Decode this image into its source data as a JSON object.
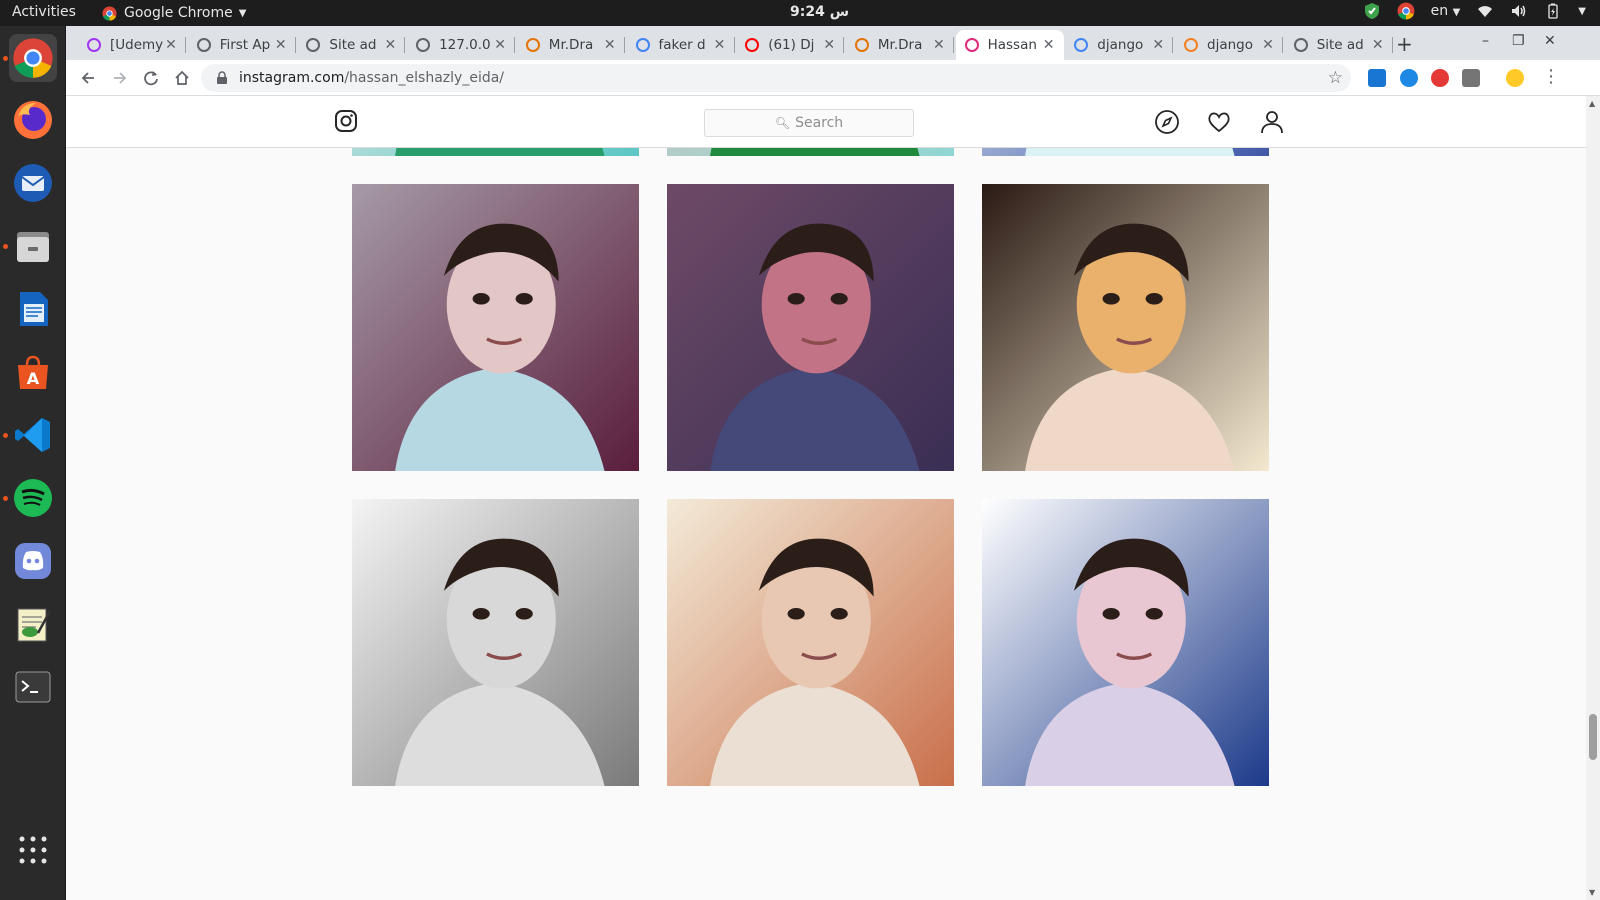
{
  "topbar": {
    "activities": "Activities",
    "app_name": "Google Chrome",
    "clock": "9:24 س",
    "lang": "en"
  },
  "browser": {
    "tabs": [
      {
        "title": "[Udemy",
        "favicon": "udemy-icon",
        "color": "#a435f0"
      },
      {
        "title": "First Ap",
        "favicon": "globe-icon",
        "color": "#5f6368"
      },
      {
        "title": "Site ad",
        "favicon": "globe-icon",
        "color": "#5f6368"
      },
      {
        "title": "127.0.0",
        "favicon": "globe-icon",
        "color": "#5f6368"
      },
      {
        "title": "Mr.Dra",
        "favicon": "bar-chart-icon",
        "color": "#e37400"
      },
      {
        "title": "faker d",
        "favicon": "google-icon",
        "color": "#4285f4"
      },
      {
        "title": "(61) Dj",
        "favicon": "youtube-icon",
        "color": "#ff0000"
      },
      {
        "title": "Mr.Dra",
        "favicon": "bar-chart-icon",
        "color": "#e37400"
      },
      {
        "title": "Hassan",
        "favicon": "instagram-icon",
        "color": "#dd2a7b",
        "active": true
      },
      {
        "title": "django",
        "favicon": "google-icon",
        "color": "#4285f4"
      },
      {
        "title": "django",
        "favicon": "stack-icon",
        "color": "#f48024"
      },
      {
        "title": "Site ad",
        "favicon": "globe-icon",
        "color": "#5f6368"
      }
    ],
    "url_host": "instagram.com",
    "url_path": "/hassan_elshazly_eida/"
  },
  "instagram": {
    "search_placeholder": "Search"
  },
  "grid": [
    {
      "id": "photo-1",
      "bg": [
        "#f4efe9",
        "#5cc6c4"
      ],
      "shirt": "#2a9d6c",
      "face": "#e6c4b4"
    },
    {
      "id": "photo-2",
      "bg": [
        "#d8c3bd",
        "#8fd6d4"
      ],
      "shirt": "#1f8a3b",
      "face": "#d7a99a"
    },
    {
      "id": "photo-3",
      "bg": [
        "#eaf4f7",
        "#4058a8"
      ],
      "shirt": "#dbf2f5",
      "face": "#e8d1c6"
    },
    {
      "id": "photo-4",
      "bg": [
        "#a69aa6",
        "#5a1e3c"
      ],
      "shirt": "#b5d8e3",
      "face": "#e3c6c6"
    },
    {
      "id": "photo-5",
      "bg": [
        "#6d4a66",
        "#3a2e54"
      ],
      "shirt": "#45497a",
      "face": "#c37386"
    },
    {
      "id": "photo-6",
      "bg": [
        "#2a1a14",
        "#f4e8cf"
      ],
      "shirt": "#efd8c8",
      "face": "#e9b16b"
    },
    {
      "id": "photo-7",
      "bg": [
        "#f4f4f4",
        "#7a7a7a"
      ],
      "shirt": "#dddddd",
      "face": "#d8d8d8"
    },
    {
      "id": "photo-8",
      "bg": [
        "#f3ead8",
        "#c96f4a"
      ],
      "shirt": "#eadfd2",
      "face": "#e8c8b2"
    },
    {
      "id": "photo-9",
      "bg": [
        "#ffffff",
        "#1c3a8a"
      ],
      "shirt": "#d9cfe6",
      "face": "#e9c7d2"
    }
  ]
}
